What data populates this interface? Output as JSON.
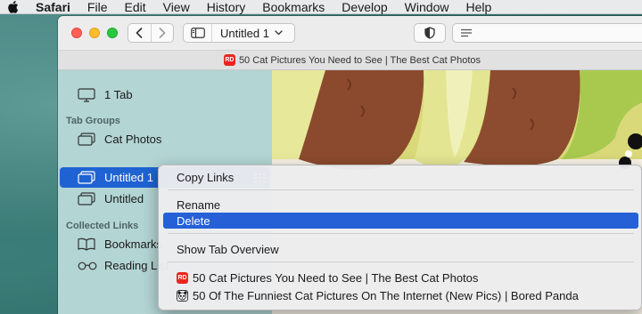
{
  "menubar": {
    "items": [
      {
        "label": "Safari",
        "bold": true
      },
      {
        "label": "File"
      },
      {
        "label": "Edit"
      },
      {
        "label": "View"
      },
      {
        "label": "History"
      },
      {
        "label": "Bookmarks"
      },
      {
        "label": "Develop"
      },
      {
        "label": "Window"
      },
      {
        "label": "Help"
      }
    ]
  },
  "toolbar": {
    "tab_group_title": "Untitled 1",
    "address_icon": "text-lines-icon",
    "privacy_icon": "shield-icon"
  },
  "tabbar": {
    "active_tab_title": "50 Cat Pictures You Need to See | The Best Cat Photos",
    "favicon_text": "RD"
  },
  "sidebar": {
    "tabs_item": "1 Tab",
    "tab_groups_header": "Tab Groups",
    "groups": [
      {
        "label": "Cat Photos"
      },
      {
        "label": "Untitled 1",
        "selected": true
      },
      {
        "label": "Untitled"
      }
    ],
    "collected_links_header": "Collected Links",
    "links": [
      {
        "label": "Bookmarks",
        "icon": "book-icon"
      },
      {
        "label": "Reading List",
        "icon": "glasses-icon"
      }
    ]
  },
  "context_menu": {
    "copy_links": "Copy Links",
    "rename": "Rename",
    "delete": "Delete",
    "show_tab_overview": "Show Tab Overview",
    "tabs": [
      {
        "title": "50 Cat Pictures You Need to See | The Best Cat Photos",
        "favicon_text": "RD"
      },
      {
        "title": "50 Of The Funniest Cat Pictures On The Internet (New Pics) | Bored Panda"
      }
    ]
  },
  "colors": {
    "selection": "#1f63d3",
    "menu_highlight": "#2560d7",
    "sidebar_bg": "#b3d5d4"
  }
}
